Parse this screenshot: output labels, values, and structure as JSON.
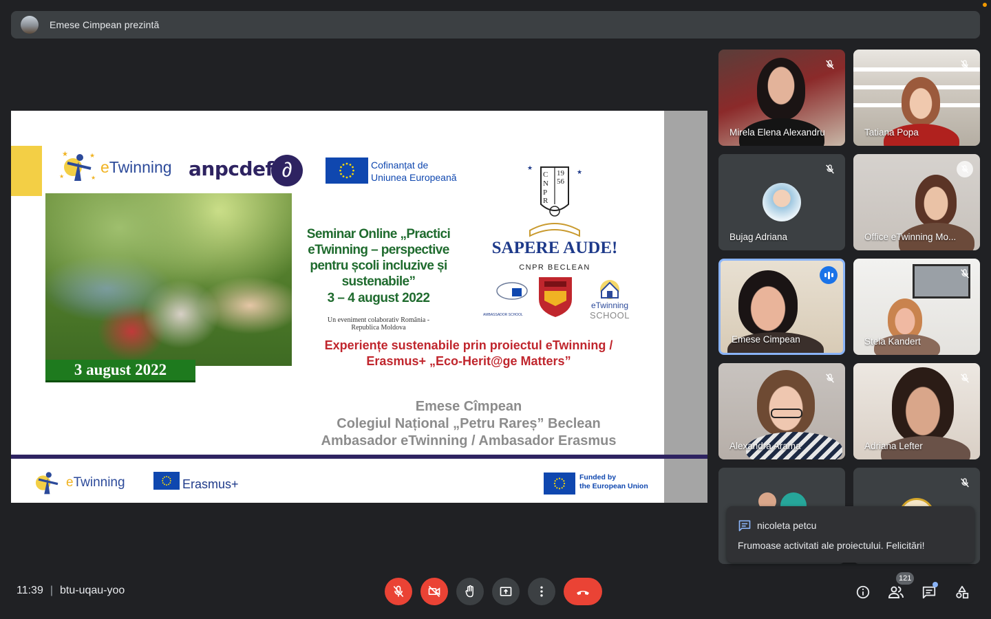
{
  "presenter": {
    "text": "Emese Cimpean prezintă"
  },
  "slide": {
    "twinning": "Twinning",
    "twinning_e": "e",
    "anpcdefp": "anpcdefp",
    "cofinantat_line1": "Cofinanțat de",
    "cofinantat_line2": "Uniunea Europeană",
    "seminar_title": "Seminar Online „Practici eTwinning – perspective pentru școli incluzive și sustenabile”",
    "seminar_date": "3 – 4 august 2022",
    "seminar_sub": "Un eveniment colaborativ România - Republica Moldova",
    "date_banner": "3 august 2022",
    "crest_text": "CNPR 1956",
    "motto": "SAPERE AUDE!",
    "school": "CNPR BECLEAN",
    "ambassador_school": "AMBASSADOR SCHOOL",
    "twinning_school_1": "eTwinning",
    "twinning_school_2": "SCHOOL",
    "experiente": "Experiențe sustenabile prin proiectul eTwinning / Erasmus+ „Eco-Herit@ge Matters”",
    "author_name": "Emese Cîmpean",
    "author_school": "Colegiul Național „Petru Rareș” Beclean",
    "author_role": "Ambasador eTwinning / Ambasador Erasmus",
    "footer_twinning": "Twinning",
    "footer_erasmus": "Erasmus+",
    "funded_line1": "Funded by",
    "funded_line2": "the European Union"
  },
  "participants": [
    {
      "name": "Mirela Elena Alexandru",
      "muted": true
    },
    {
      "name": "Tatiana Popa",
      "muted": true
    },
    {
      "name": "Bujag Adriana",
      "muted": true
    },
    {
      "name": "Office eTwinning Mo...",
      "muted": true
    },
    {
      "name": "Emese Cimpean",
      "speaking": true
    },
    {
      "name": "Stela Kandert",
      "muted": true
    },
    {
      "name": "Alexandra Arama",
      "muted": true
    },
    {
      "name": "Adriana Lefter",
      "muted": true
    }
  ],
  "chat_toast": {
    "sender": "nicoleta petcu",
    "message": "Frumoase activitati ale proiectului. Felicitări!"
  },
  "meeting": {
    "time": "11:39",
    "separator": "|",
    "code": "btu-uqau-yoo",
    "participant_count": "121"
  },
  "colors": {
    "background": "#202124",
    "hangup": "#ea4335",
    "active_speaker": "#8ab4f8"
  }
}
